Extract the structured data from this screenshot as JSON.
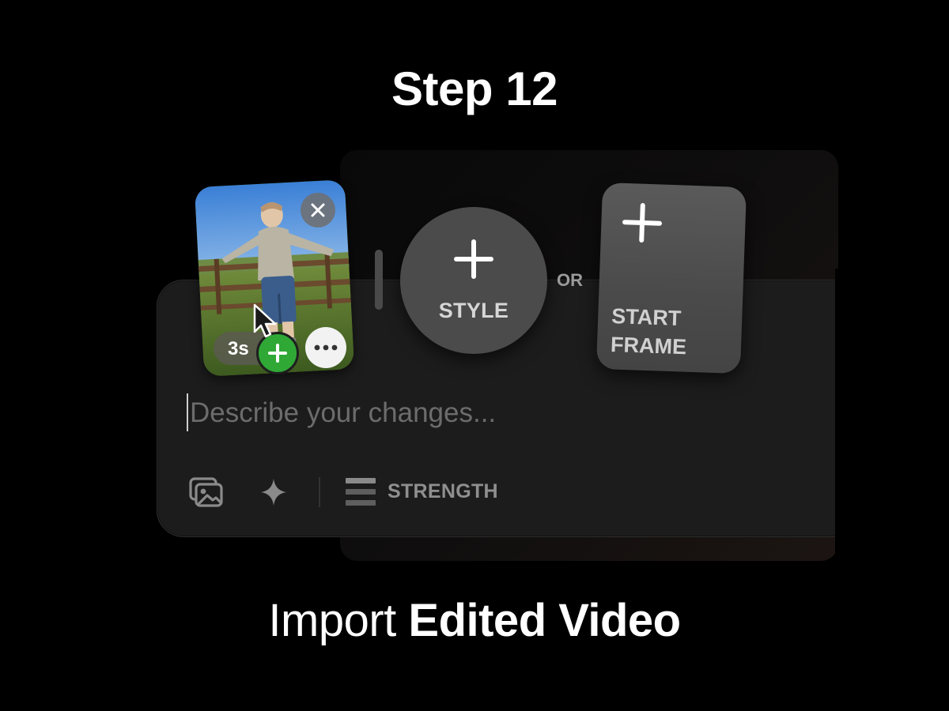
{
  "header": {
    "step_title": "Step 12"
  },
  "caption": {
    "prefix": "Import",
    "emphasis": "Edited Video"
  },
  "video_card": {
    "duration": "3s"
  },
  "style_card": {
    "label": "STYLE"
  },
  "or_text": "OR",
  "start_frame_card": {
    "line1": "START",
    "line2": "FRAME"
  },
  "prompt": {
    "placeholder": "Describe your changes..."
  },
  "toolbar": {
    "strength_label": "STRENGTH"
  },
  "colors": {
    "background": "#000000",
    "panel": "#1c1c1c",
    "add_green": "#2fa836"
  },
  "icons": [
    "close-icon",
    "add-icon",
    "more-icon",
    "cursor-icon",
    "gallery-icon",
    "sparkle-icon",
    "strength-icon"
  ]
}
